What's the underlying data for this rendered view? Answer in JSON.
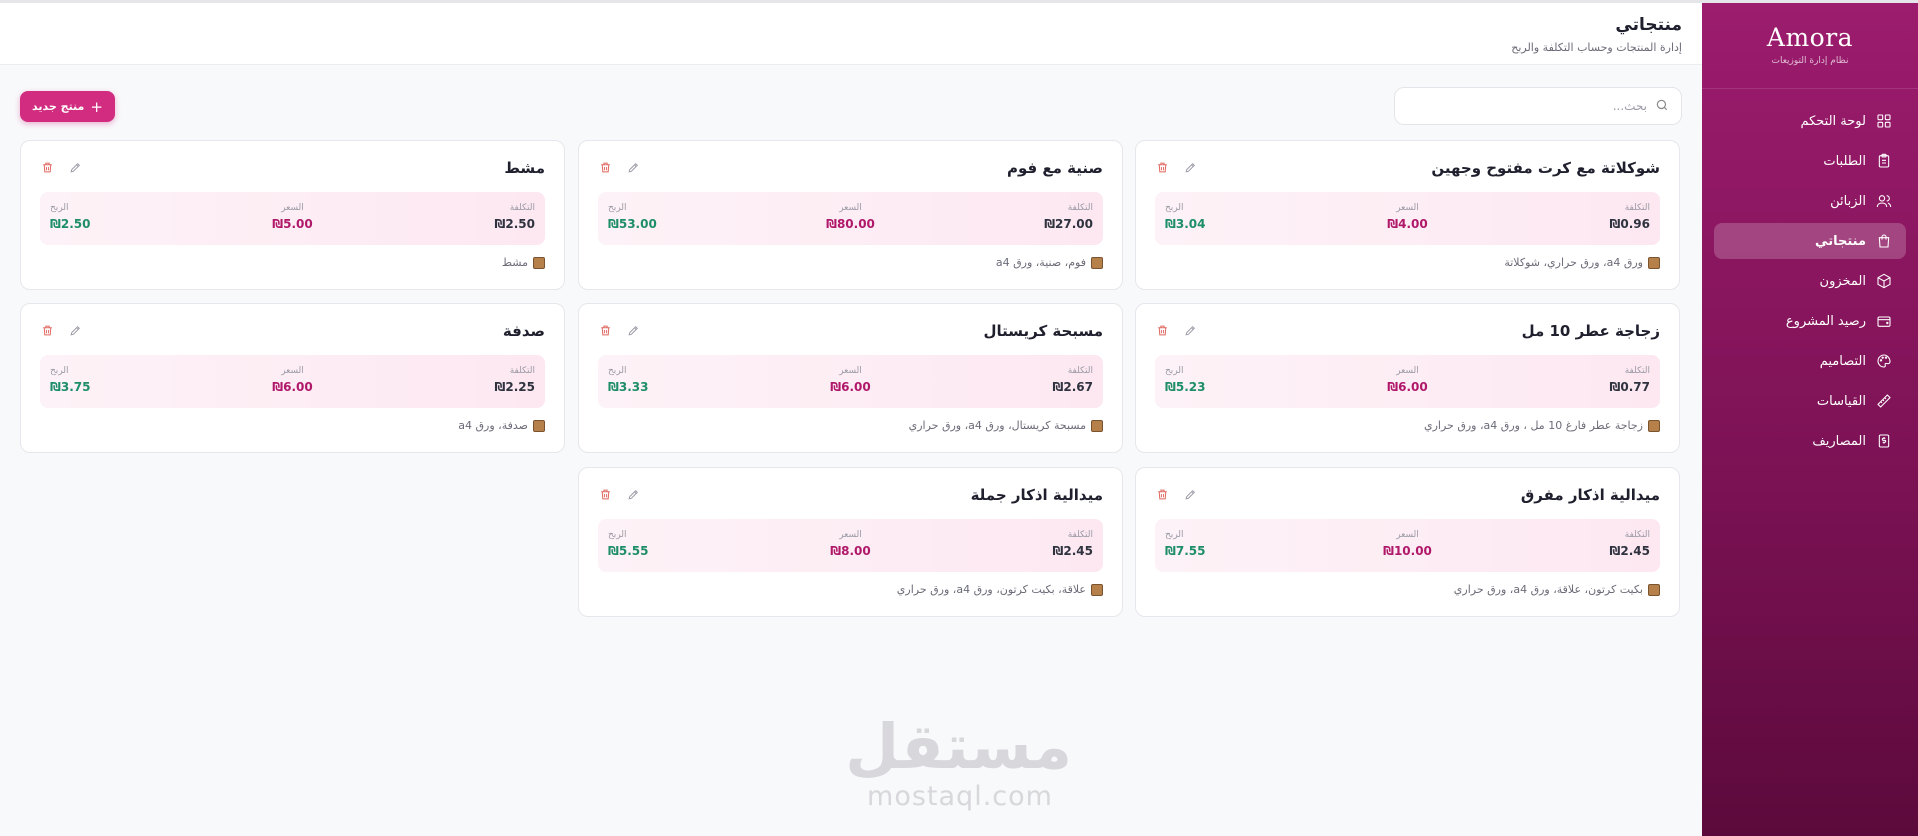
{
  "brand": {
    "name": "Amora",
    "subtitle": "نظام إدارة التوزيعات"
  },
  "sidebar": {
    "items": [
      {
        "label": "لوحة التحكم",
        "icon": "dashboard-icon"
      },
      {
        "label": "الطلبات",
        "icon": "clipboard-icon"
      },
      {
        "label": "الزبائن",
        "icon": "users-icon"
      },
      {
        "label": "منتجاتي",
        "icon": "shopping-bag-icon",
        "active": true
      },
      {
        "label": "المخزون",
        "icon": "package-icon"
      },
      {
        "label": "رصيد المشروع",
        "icon": "wallet-icon"
      },
      {
        "label": "التصاميم",
        "icon": "palette-icon"
      },
      {
        "label": "القياسات",
        "icon": "ruler-icon"
      },
      {
        "label": "المصاريف",
        "icon": "receipt-icon"
      }
    ]
  },
  "header": {
    "title": "منتجاتي",
    "subtitle": "إدارة المنتجات وحساب التكلفة والربح"
  },
  "toolbar": {
    "search_placeholder": "بحث...",
    "new_product_label": "منتج جديد"
  },
  "labels": {
    "cost": "التكلفة",
    "price": "السعر",
    "profit": "الربح"
  },
  "products": [
    {
      "name": "شوكلاتة مع كرت مفتوح وجهين",
      "cost": "₪0.96",
      "price": "₪4.00",
      "profit": "₪3.04",
      "materials": "ورق a4، ورق حراري، شوكلاتة"
    },
    {
      "name": "صنية مع فوم",
      "cost": "₪27.00",
      "price": "₪80.00",
      "profit": "₪53.00",
      "materials": "فوم، صنية، ورق a4"
    },
    {
      "name": "مشط",
      "cost": "₪2.50",
      "price": "₪5.00",
      "profit": "₪2.50",
      "materials": "مشط"
    },
    {
      "name": "زجاجة عطر 10 مل",
      "cost": "₪0.77",
      "price": "₪6.00",
      "profit": "₪5.23",
      "materials": "زجاجة عطر فارغ 10 مل ، ورق a4، ورق حراري"
    },
    {
      "name": "مسبحة كريستال",
      "cost": "₪2.67",
      "price": "₪6.00",
      "profit": "₪3.33",
      "materials": "مسبحة كريستال، ورق a4، ورق حراري"
    },
    {
      "name": "صدفة",
      "cost": "₪2.25",
      "price": "₪6.00",
      "profit": "₪3.75",
      "materials": "صدفة، ورق a4"
    },
    {
      "name": "ميدالية اذكار مفرق",
      "cost": "₪2.45",
      "price": "₪10.00",
      "profit": "₪7.55",
      "materials": "بكيت كرتون، علاقة، ورق a4، ورق حراري"
    },
    {
      "name": "ميدالية اذكار جملة",
      "cost": "₪2.45",
      "price": "₪8.00",
      "profit": "₪5.55",
      "materials": "علاقة، بكيت كرتون، ورق a4، ورق حراري"
    }
  ],
  "watermark": {
    "arabic": "مستقل",
    "latin": "mostaql.com"
  }
}
